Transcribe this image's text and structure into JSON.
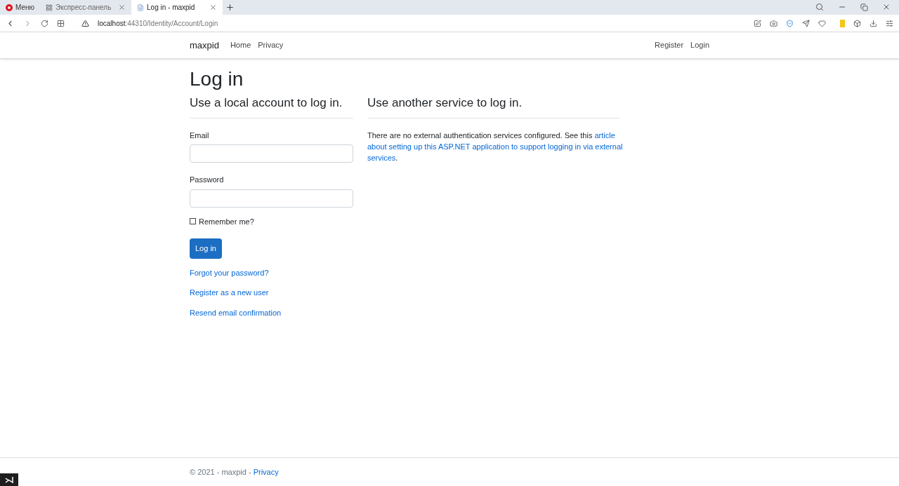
{
  "browser": {
    "menu_label": "Меню",
    "tabs": [
      {
        "title": "Экспресс-панель",
        "selected": false
      },
      {
        "title": "Log in - maxpid",
        "selected": true
      }
    ],
    "address": {
      "host": "localhost",
      "path": ":44310/Identity/Account/Login"
    }
  },
  "navbar": {
    "brand": "maxpid",
    "links": [
      "Home",
      "Privacy"
    ],
    "right_links": [
      "Register",
      "Login"
    ]
  },
  "page": {
    "title": "Log in",
    "local": {
      "heading": "Use a local account to log in.",
      "email_label": "Email",
      "password_label": "Password",
      "remember": {
        "label": "Remember me?",
        "checked": false
      },
      "submit": "Log in",
      "links": [
        "Forgot your password?",
        "Register as a new user",
        "Resend email confirmation"
      ]
    },
    "external": {
      "heading": "Use another service to log in.",
      "text_before": "There are no external authentication services configured. See this ",
      "link_lines": [
        "article",
        "about setting up this ASP.NET application to support logging in via external",
        "services"
      ],
      "text_after": "."
    }
  },
  "footer": {
    "text": "© 2021 - maxpid - ",
    "link": "Privacy"
  }
}
